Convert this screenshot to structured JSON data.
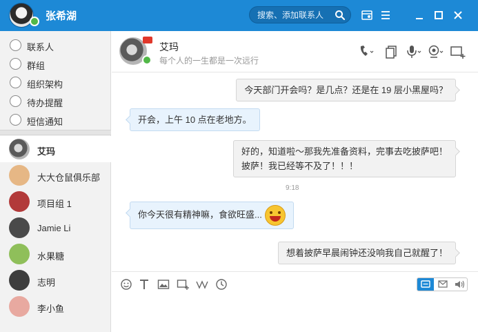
{
  "account": {
    "name": "张希湖"
  },
  "search": {
    "placeholder": "搜索、添加联系人"
  },
  "nav": {
    "items": [
      {
        "label": "联系人"
      },
      {
        "label": "群组"
      },
      {
        "label": "组织架构"
      },
      {
        "label": "待办提醒"
      },
      {
        "label": "短信通知"
      }
    ]
  },
  "contacts": [
    {
      "name": "艾玛",
      "active": true,
      "color": "#6b6b6b"
    },
    {
      "name": "大大仓鼠俱乐部",
      "color": "#e6b785"
    },
    {
      "name": "项目组 1",
      "color": "#b23a3a"
    },
    {
      "name": "Jamie Li",
      "color": "#4a4a4a"
    },
    {
      "name": "水果糖",
      "color": "#8fbf5a"
    },
    {
      "name": "志明",
      "color": "#3d3d3d"
    },
    {
      "name": "李小鱼",
      "color": "#e8a9a0"
    }
  ],
  "chat": {
    "peer_name": "艾玛",
    "peer_status": "每个人的一生都是一次远行",
    "messages": [
      {
        "dir": "out",
        "text": "今天部门开会吗？是几点？还是在 19 层小黑屋吗？"
      },
      {
        "dir": "in",
        "text": "开会，上午 10 点在老地方。"
      },
      {
        "dir": "out",
        "lines": [
          "好的，知道啦～那我先准备资料，完事去吃披萨吧！",
          "披萨！我已经等不及了！！！"
        ]
      },
      {
        "dir": "in",
        "text": "你今天很有精神嘛，食欲旺盛..."
      },
      {
        "dir": "out",
        "text": "想着披萨早晨闹钟还没响我自己就醒了！"
      }
    ],
    "timestamp": "9:18"
  },
  "colors": {
    "titlebar": "#1d89d6",
    "online": "#52b848",
    "bubble_in": "#e8f3fd",
    "bubble_out": "#f2f2f2"
  },
  "icons": {
    "titlebar": [
      "search-icon",
      "skin-icon",
      "menu-icon",
      "minimize-icon",
      "maximize-icon",
      "close-icon"
    ],
    "header": [
      "phone-icon",
      "files-icon",
      "microphone-icon",
      "camera-icon",
      "add-member-icon"
    ],
    "toolbar": [
      "emoji-icon",
      "font-icon",
      "image-icon",
      "screenshot-icon",
      "shake-icon",
      "history-icon"
    ],
    "modes": [
      "chat-mode-icon",
      "sms-mode-icon",
      "voice-mode-icon"
    ]
  }
}
